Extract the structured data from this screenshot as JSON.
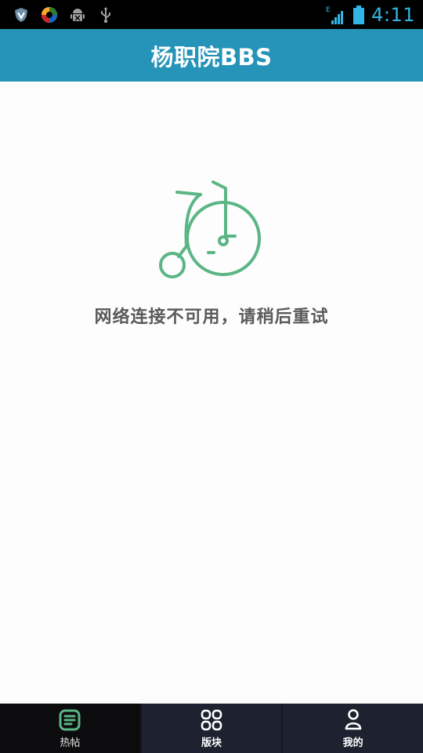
{
  "status_bar": {
    "time": "4:11",
    "network_type": "E",
    "icons": [
      "shield-icon",
      "photo-app-icon",
      "android-debug-icon",
      "usb-icon",
      "signal-icon",
      "battery-icon"
    ],
    "time_color": "#33b5e5"
  },
  "header": {
    "title": "杨职院BBS",
    "background_color": "#2594b8"
  },
  "main": {
    "illustration": "bicycle-icon",
    "message": "网络连接不可用，请稍后重试",
    "accent_color": "#5bb585"
  },
  "bottom_nav": {
    "tabs": [
      {
        "label": "热帖",
        "icon": "hot-posts-icon",
        "active": true
      },
      {
        "label": "版块",
        "icon": "boards-grid-icon",
        "active": false
      },
      {
        "label": "我的",
        "icon": "profile-icon",
        "active": false
      }
    ],
    "active_color": "#5bb585"
  }
}
